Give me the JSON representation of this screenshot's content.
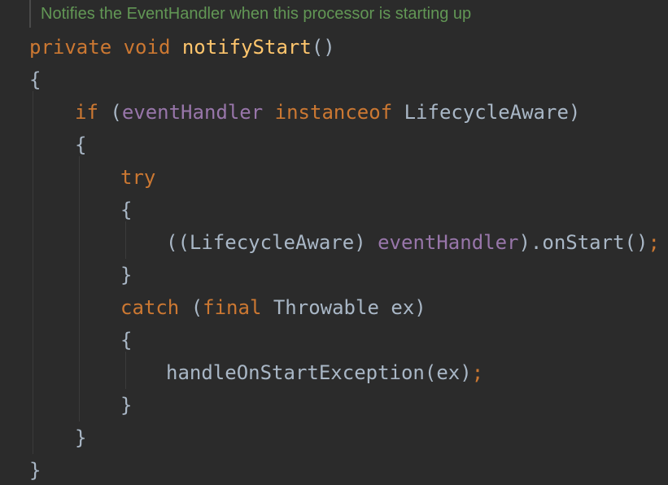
{
  "editor": {
    "doc_comment": "Notifies the EventHandler when this processor is starting up",
    "lines": [
      {
        "tokens": [
          {
            "t": "private",
            "k": "kw"
          },
          {
            "t": " ",
            "k": "plain"
          },
          {
            "t": "void",
            "k": "kw"
          },
          {
            "t": " ",
            "k": "plain"
          },
          {
            "t": "notifyStart",
            "k": "fn"
          },
          {
            "t": "()",
            "k": "plain"
          }
        ]
      },
      {
        "tokens": [
          {
            "t": "{",
            "k": "plain"
          }
        ]
      },
      {
        "tokens": [
          {
            "t": "if",
            "k": "kw"
          },
          {
            "t": " (",
            "k": "plain"
          },
          {
            "t": "eventHandler",
            "k": "fld"
          },
          {
            "t": " ",
            "k": "plain"
          },
          {
            "t": "instanceof",
            "k": "kw"
          },
          {
            "t": " LifecycleAware)",
            "k": "plain"
          }
        ]
      },
      {
        "tokens": [
          {
            "t": "{",
            "k": "plain"
          }
        ]
      },
      {
        "tokens": [
          {
            "t": "try",
            "k": "kw"
          }
        ]
      },
      {
        "tokens": [
          {
            "t": "{",
            "k": "plain"
          }
        ]
      },
      {
        "tokens": [
          {
            "t": "((LifecycleAware) ",
            "k": "plain"
          },
          {
            "t": "eventHandler",
            "k": "fld"
          },
          {
            "t": ").onStart()",
            "k": "plain"
          },
          {
            "t": ";",
            "k": "semi"
          }
        ]
      },
      {
        "tokens": [
          {
            "t": "}",
            "k": "plain"
          }
        ]
      },
      {
        "tokens": [
          {
            "t": "catch",
            "k": "kw"
          },
          {
            "t": " (",
            "k": "plain"
          },
          {
            "t": "final",
            "k": "kw"
          },
          {
            "t": " Throwable ex)",
            "k": "plain"
          }
        ]
      },
      {
        "tokens": [
          {
            "t": "{",
            "k": "plain"
          }
        ]
      },
      {
        "tokens": [
          {
            "t": "handleOnStartException(ex)",
            "k": "plain"
          },
          {
            "t": ";",
            "k": "semi"
          }
        ]
      },
      {
        "tokens": [
          {
            "t": "}",
            "k": "plain"
          }
        ]
      },
      {
        "tokens": [
          {
            "t": "}",
            "k": "plain"
          }
        ]
      },
      {
        "tokens": [
          {
            "t": "}",
            "k": "plain"
          }
        ]
      }
    ]
  },
  "colors": {
    "background": "#2b2b2b",
    "keyword": "#cc7832",
    "method_declaration": "#ffc66d",
    "field": "#9876aa",
    "identifier": "#a9b7c6",
    "doc_comment": "#629755"
  }
}
